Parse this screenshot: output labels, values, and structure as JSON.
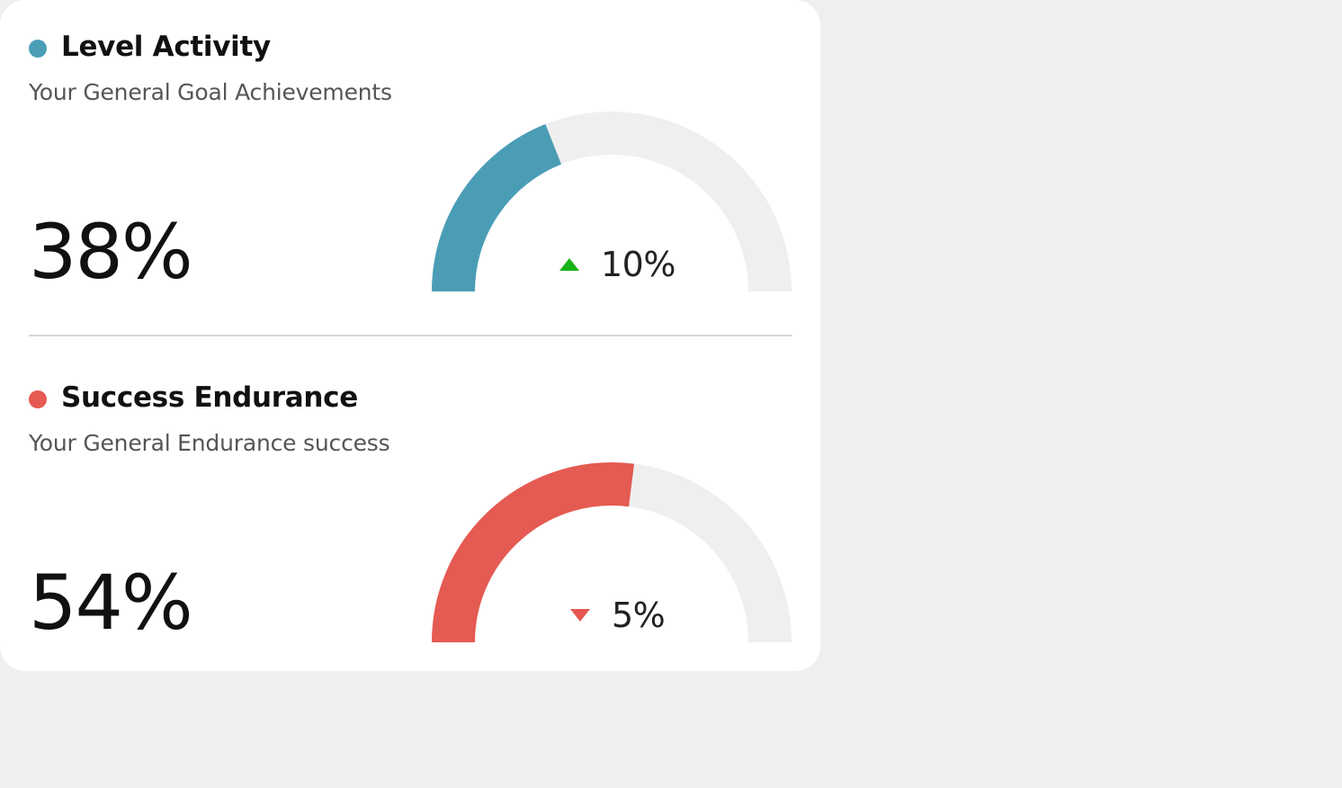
{
  "colors": {
    "page_background": "#efefef",
    "card_background": "#ffffff",
    "track": "#efefef",
    "up_arrow": "#17b317",
    "down_arrow": "#e55750"
  },
  "metrics": [
    {
      "title": "Level Activity",
      "subtitle": "Your General Goal Achievements",
      "value": "38%",
      "gauge_fraction": 0.38,
      "change": "10%",
      "trend": "up",
      "trend_icon": "triangle-up-icon",
      "color": "#4b9db6"
    },
    {
      "title": "Success Endurance",
      "subtitle": "Your General Endurance success",
      "value": "54%",
      "gauge_fraction": 0.54,
      "change": "5%",
      "trend": "down",
      "trend_icon": "triangle-down-icon",
      "color": "#e55a52"
    }
  ]
}
